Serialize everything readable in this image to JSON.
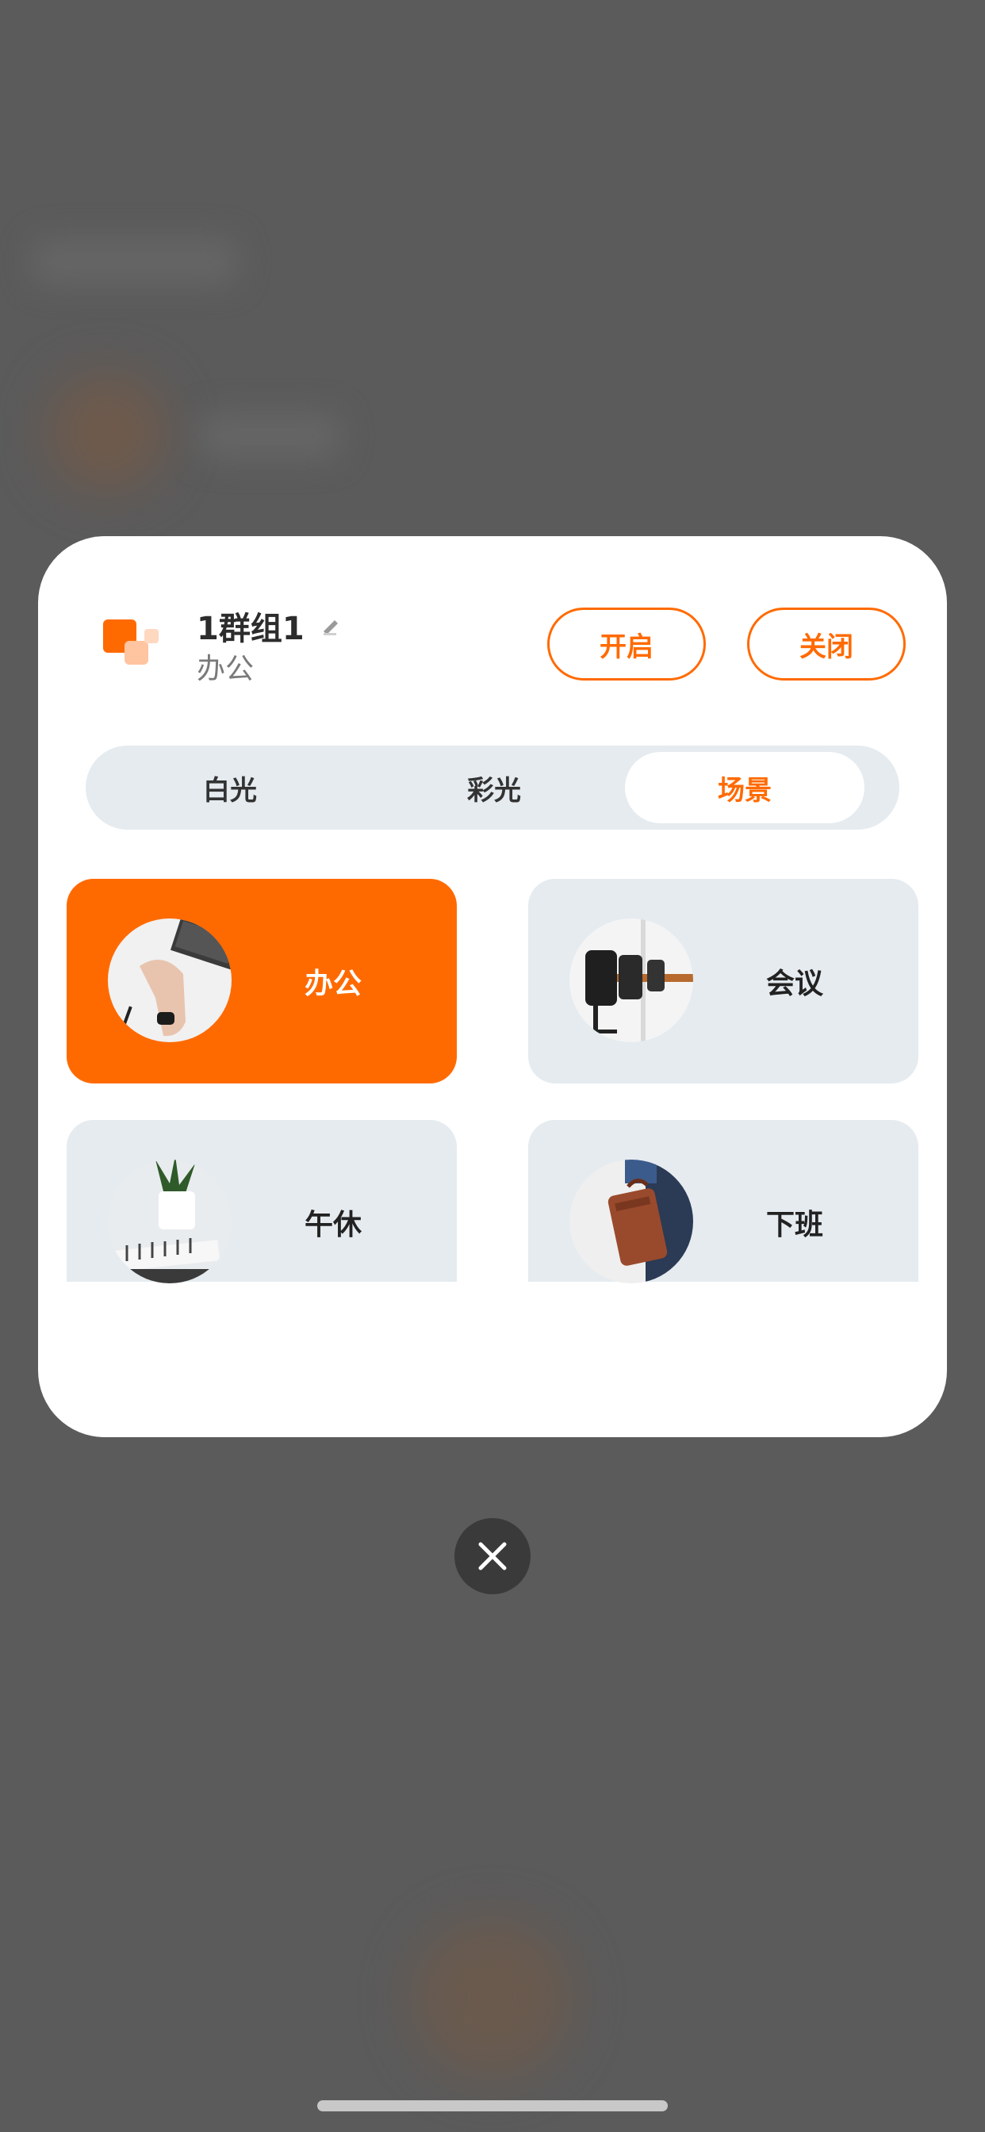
{
  "group": {
    "title": "1群组1",
    "subtitle": "办公",
    "on_label": "开启",
    "off_label": "关闭"
  },
  "tabs": [
    {
      "label": "白光",
      "selected": false
    },
    {
      "label": "彩光",
      "selected": false
    },
    {
      "label": "场景",
      "selected": true
    }
  ],
  "scenes": [
    {
      "label": "办公",
      "selected": true,
      "image": "office-laptop-photo"
    },
    {
      "label": "会议",
      "selected": false,
      "image": "meeting-room-photo"
    },
    {
      "label": "午休",
      "selected": false,
      "image": "desk-plant-photo"
    },
    {
      "label": "下班",
      "selected": false,
      "image": "briefcase-photo"
    }
  ],
  "colors": {
    "accent": "#ff6a00",
    "tab_background": "#e5ebef",
    "overlay": "#5b5b5b"
  },
  "icons": [
    "group-icon",
    "edit-icon",
    "close-icon"
  ]
}
